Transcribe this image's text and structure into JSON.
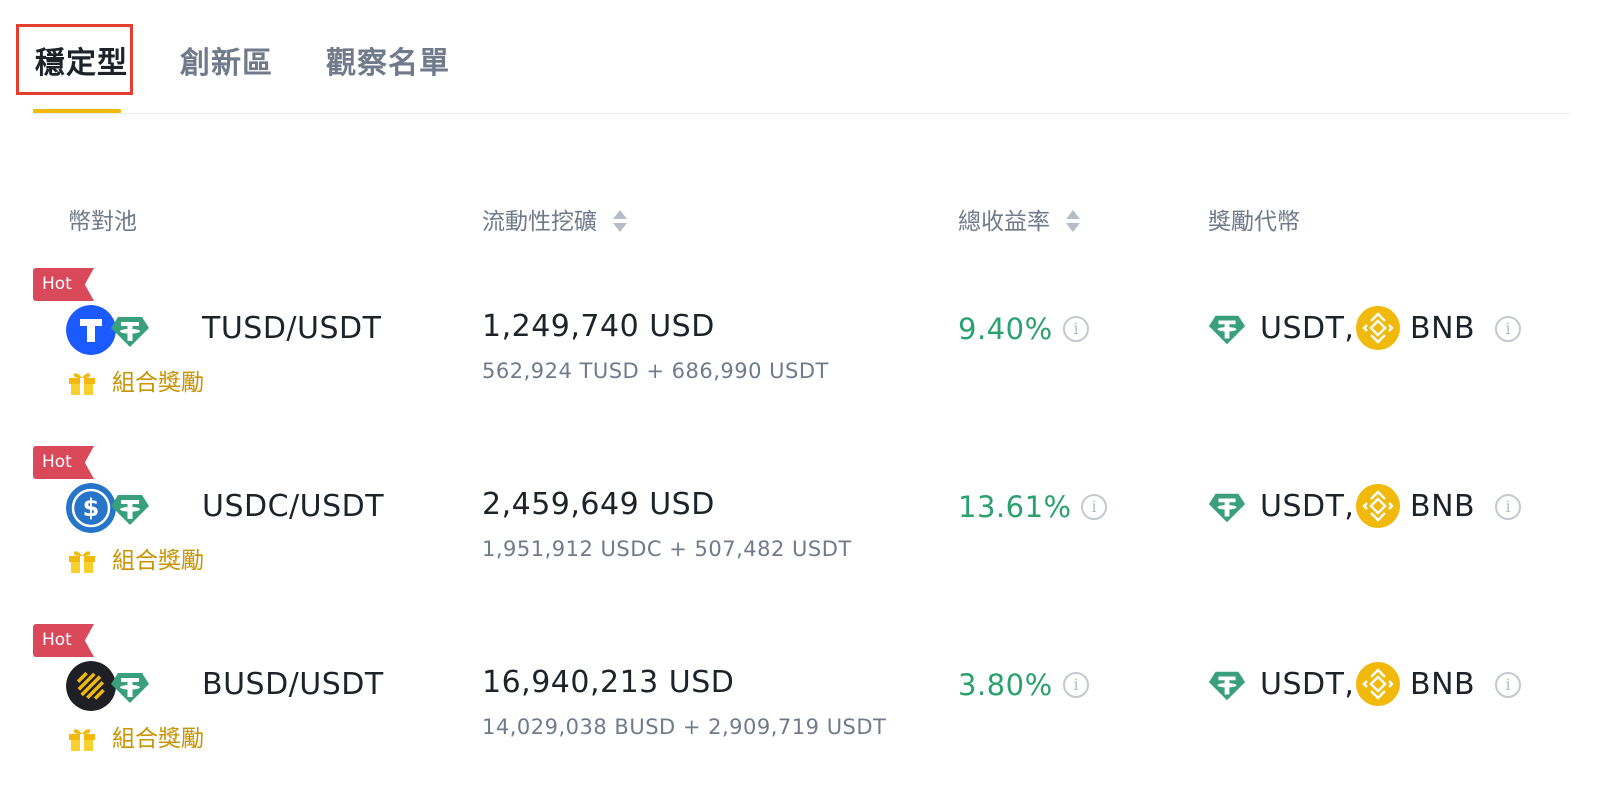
{
  "tabs": [
    {
      "label": "穩定型",
      "active": true
    },
    {
      "label": "創新區",
      "active": false
    },
    {
      "label": "觀察名單",
      "active": false
    }
  ],
  "columns": {
    "pool": "幣對池",
    "liquidity": "流動性挖礦",
    "apr": "總收益率",
    "reward": "獎勵代幣"
  },
  "rows": [
    {
      "badge": "Hot",
      "pair": "TUSD/USDT",
      "base_icon": "tusd-icon",
      "quote_icon": "usdt-icon",
      "combo_label": "組合獎勵",
      "liquidity": "1,249,740 USD",
      "liquidity_breakdown": "562,924 TUSD + 686,990 USDT",
      "apr": "9.40%",
      "reward_1": "USDT,",
      "reward_2": "BNB"
    },
    {
      "badge": "Hot",
      "pair": "USDC/USDT",
      "base_icon": "usdc-icon",
      "quote_icon": "usdt-icon",
      "combo_label": "組合獎勵",
      "liquidity": "2,459,649 USD",
      "liquidity_breakdown": "1,951,912 USDC + 507,482 USDT",
      "apr": "13.61%",
      "reward_1": "USDT,",
      "reward_2": "BNB"
    },
    {
      "badge": "Hot",
      "pair": "BUSD/USDT",
      "base_icon": "busd-icon",
      "quote_icon": "usdt-icon",
      "combo_label": "組合獎勵",
      "liquidity": "16,940,213 USD",
      "liquidity_breakdown": "14,029,038 BUSD + 2,909,719 USDT",
      "apr": "3.80%",
      "reward_1": "USDT,",
      "reward_2": "BNB"
    }
  ],
  "colors": {
    "accent": "#f0b90b",
    "positive": "#2aa16f",
    "hot_badge": "#d9495a",
    "combo": "#c99400",
    "highlight_box": "#e53e2f",
    "usdt": "#3a9f7c",
    "bnb": "#f0b90b",
    "tusd": "#1a5aff",
    "usdc": "#2775ca",
    "busd": "#1e2026"
  }
}
